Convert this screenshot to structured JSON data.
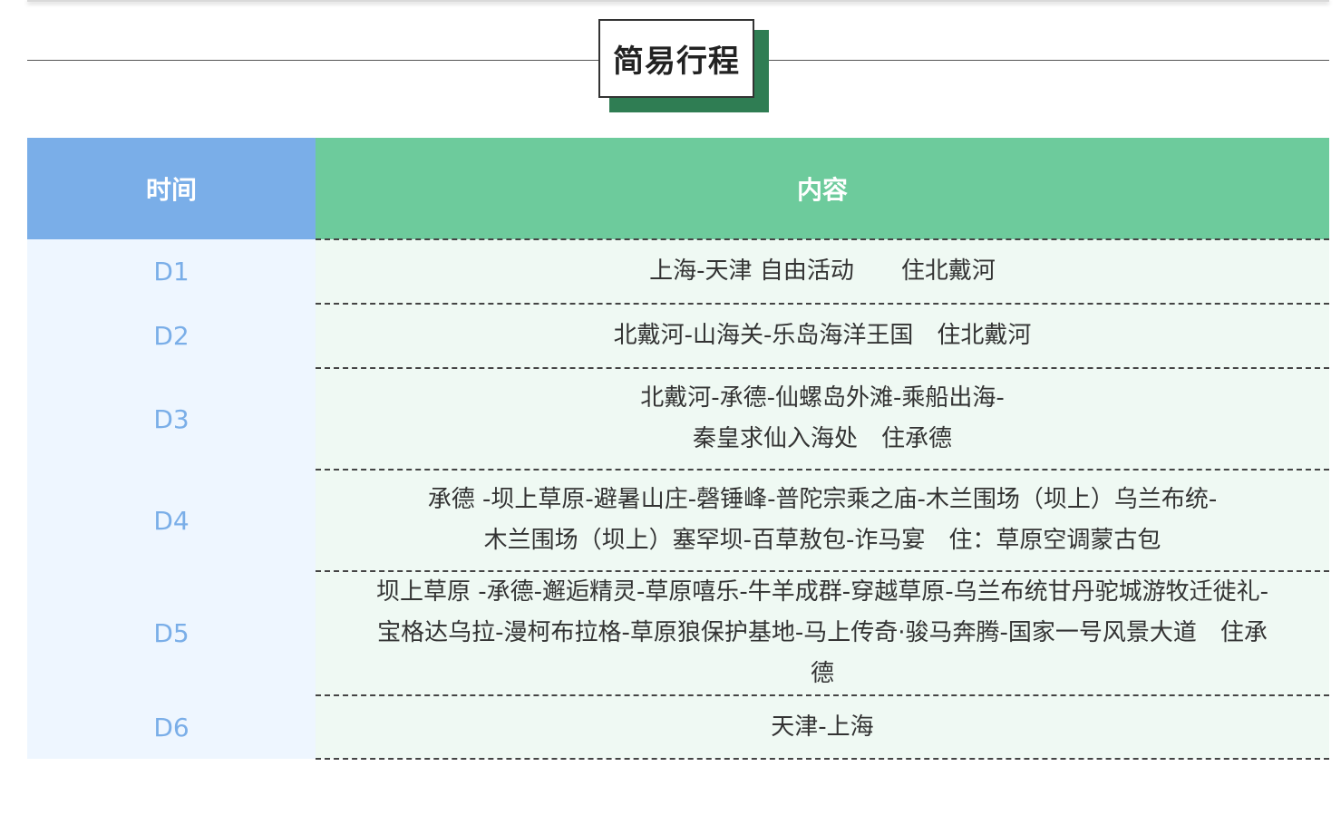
{
  "title": "简易行程",
  "table": {
    "headers": {
      "time": "时间",
      "content": "内容"
    },
    "rows": [
      {
        "day": "D1",
        "lines": [
          "上海-天津 自由活动　　住北戴河"
        ]
      },
      {
        "day": "D2",
        "lines": [
          "北戴河-山海关-乐岛海洋王国　住北戴河"
        ]
      },
      {
        "day": "D3",
        "lines": [
          "北戴河-承德-仙螺岛外滩-乘船出海-",
          "秦皇求仙入海处　住承德"
        ]
      },
      {
        "day": "D4",
        "lines": [
          "承德 -坝上草原-避暑山庄-磬锤峰-普陀宗乘之庙-木兰围场（坝上）乌兰布统-",
          "木兰围场（坝上）塞罕坝-百草敖包-诈马宴　住：草原空调蒙古包"
        ]
      },
      {
        "day": "D5",
        "lines": [
          "坝上草原 -承德-邂逅精灵-草原嘻乐-牛羊成群-穿越草原-乌兰布统甘丹驼城游牧迁徙礼-",
          "宝格达乌拉-漫柯布拉格-草原狼保护基地-马上传奇·骏马奔腾-国家一号风景大道　住承",
          "德"
        ]
      },
      {
        "day": "D6",
        "lines": [
          "天津-上海"
        ]
      }
    ]
  }
}
